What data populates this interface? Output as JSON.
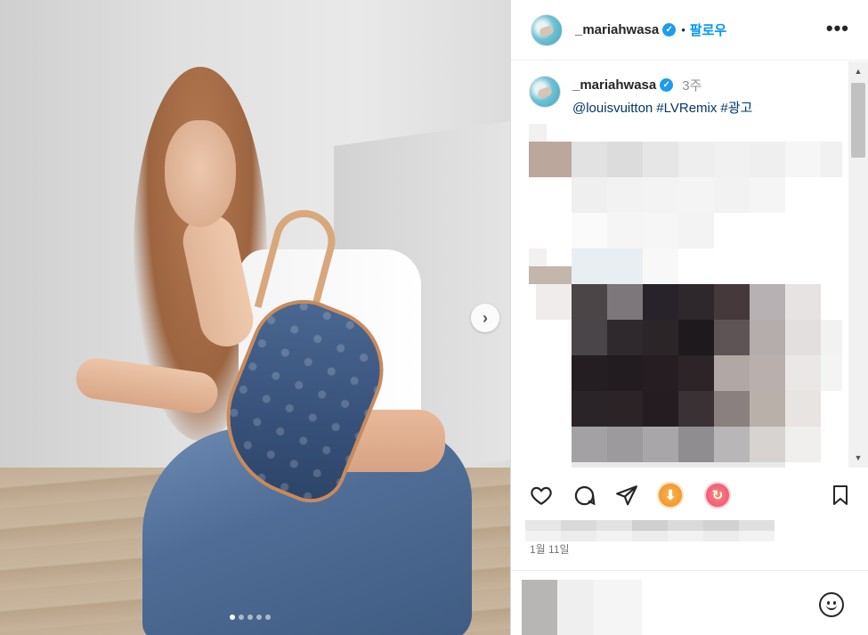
{
  "post": {
    "image_count": 5,
    "current_image": 1
  },
  "header": {
    "username": "_mariahwasa",
    "separator": "•",
    "follow_label": "팔로우",
    "more_label": "•••"
  },
  "caption": {
    "username": "_mariahwasa",
    "time_ago": "3주",
    "tags": [
      "@louisvuitton",
      "#LVRemix",
      "#광고"
    ]
  },
  "footer": {
    "date": "1월 11일"
  },
  "icons": {
    "verified": "verified-badge-icon",
    "like": "heart-icon",
    "comment": "comment-icon",
    "share": "send-icon",
    "download": "download-extension-icon",
    "repost": "repost-extension-icon",
    "save": "bookmark-icon",
    "emoji": "emoji-icon",
    "next": "chevron-right-icon"
  },
  "colors": {
    "accent": "#0095f6",
    "verified": "#1d9bf0",
    "tag": "#00376b",
    "muted": "#8e8e8e",
    "download_badge": "#f2a33a",
    "repost_badge": "#ef5a5a"
  }
}
